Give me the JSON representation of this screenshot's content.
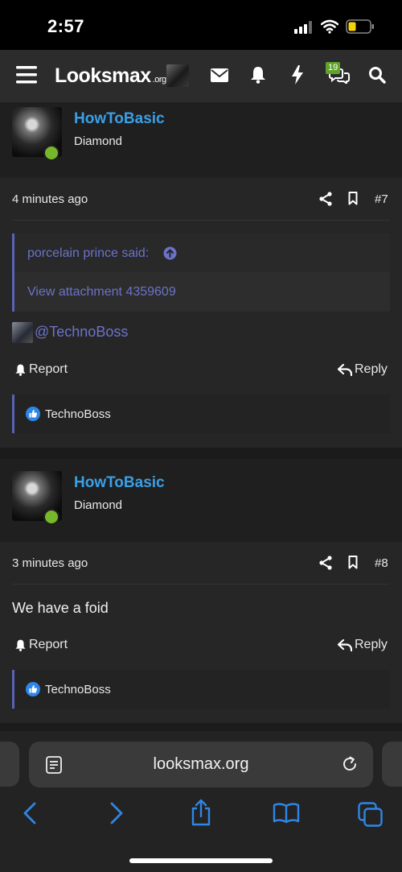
{
  "status": {
    "time": "2:57"
  },
  "header": {
    "logo": "Looksmax",
    "logo_domain": ".org",
    "alert_badge": "19"
  },
  "posts": [
    {
      "username": "HowToBasic",
      "rank": "Diamond",
      "time": "4 minutes ago",
      "number": "#7",
      "quote_author": "porcelain prince said:",
      "quote_attachment": "View attachment 4359609",
      "mention": "@TechnoBoss",
      "report_label": "Report",
      "reply_label": "Reply",
      "reaction_user": "TechnoBoss"
    },
    {
      "username": "HowToBasic",
      "rank": "Diamond",
      "time": "3 minutes ago",
      "number": "#8",
      "text": "We have a foid",
      "report_label": "Report",
      "reply_label": "Reply",
      "reaction_user": "TechnoBoss"
    }
  ],
  "browser": {
    "url": "looksmax.org"
  },
  "colors": {
    "username": "#3aa0e6",
    "link": "#6c72c8",
    "accent_blue": "#2f86e6",
    "online": "#76b82a",
    "battery": "#f5d20a"
  },
  "icons": [
    "hamburger-icon",
    "mail-icon",
    "bell-icon",
    "bolt-icon",
    "chat-icon",
    "search-icon",
    "share-icon",
    "bookmark-icon",
    "arrow-up-circle-icon",
    "reply-icon",
    "like-icon",
    "reader-icon",
    "reload-icon",
    "back-icon",
    "forward-icon",
    "share-sheet-icon",
    "bookmarks-icon",
    "tabs-icon"
  ]
}
